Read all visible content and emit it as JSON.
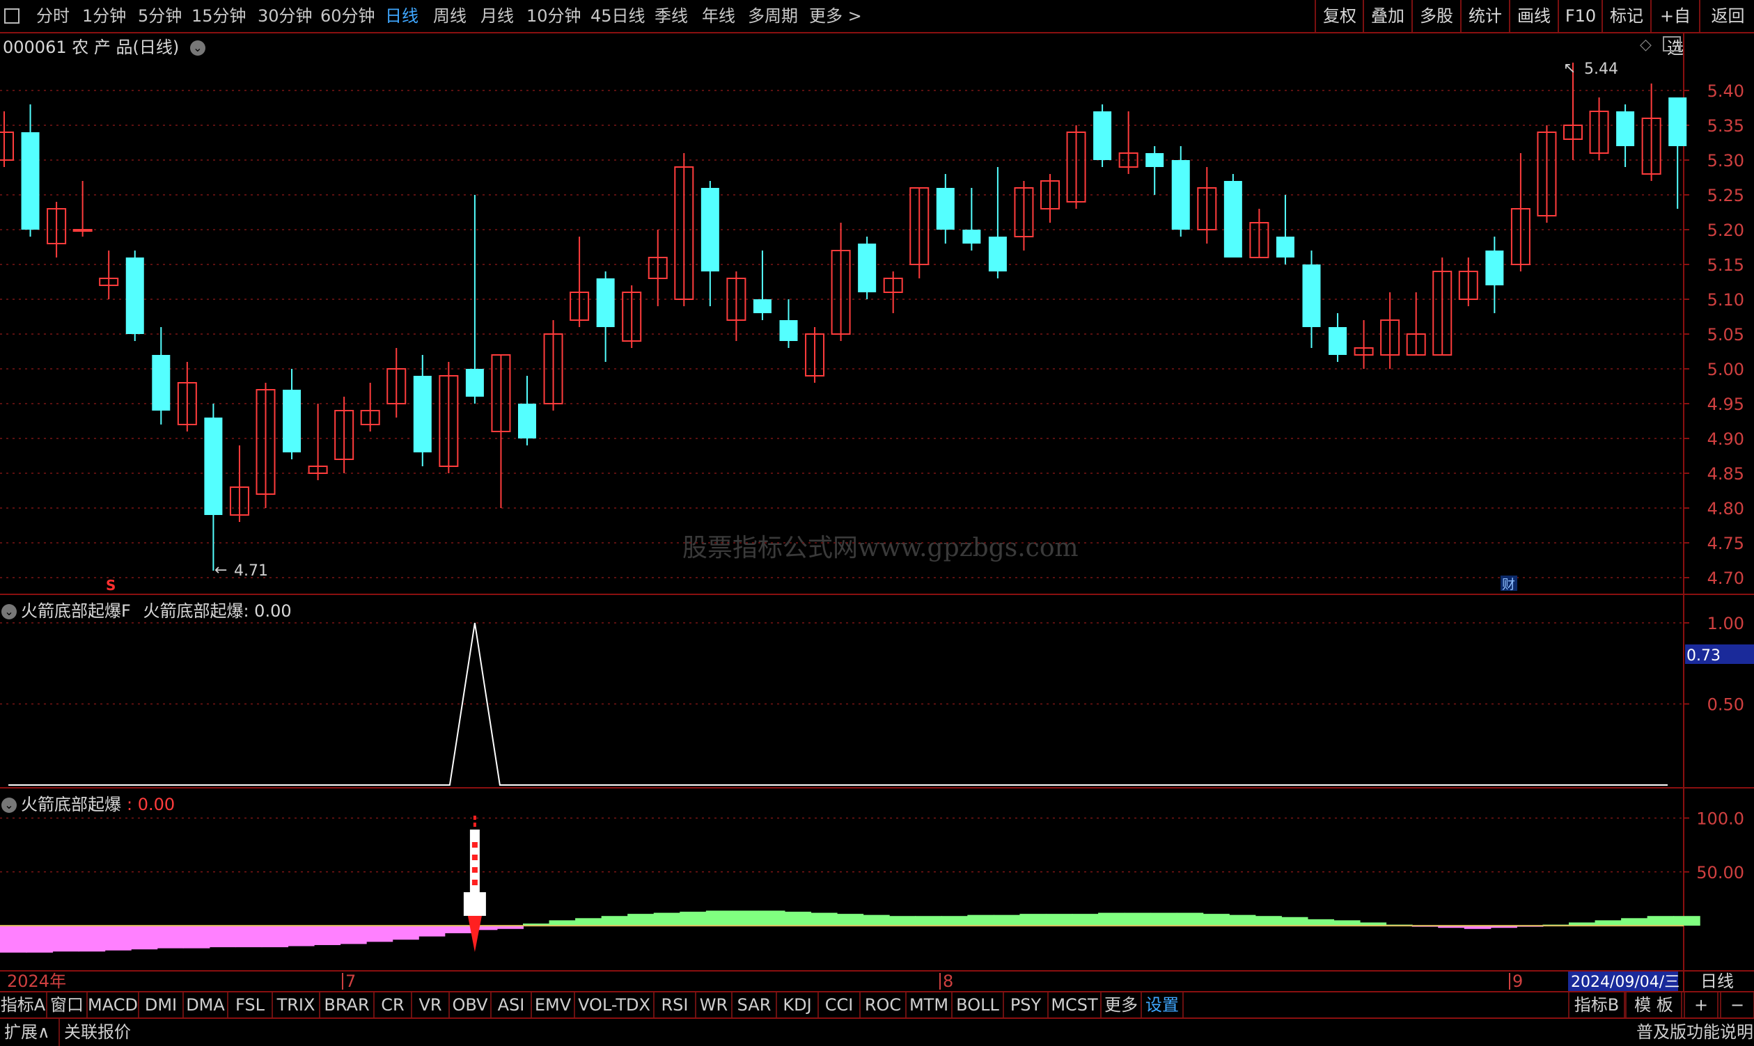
{
  "top_tabs": [
    "分时",
    "1分钟",
    "5分钟",
    "15分钟",
    "30分钟",
    "60分钟",
    "日线",
    "周线",
    "月线",
    "10分钟",
    "45日线",
    "季线",
    "年线",
    "多周期",
    "更多 >"
  ],
  "active_tab": "日线",
  "right_buttons": [
    "复权",
    "叠加",
    "多股",
    "统计",
    "画线",
    "F10",
    "标记",
    "+自选",
    "返回"
  ],
  "main_title": "000061 农 产 品(日线)",
  "watermark": "股票指标公式网www.gpzbgs.com",
  "high_label": "5.44",
  "low_label": "4.71",
  "sell_marker": "S",
  "finance_marker": "财",
  "price_axis": [
    "5.40",
    "5.35",
    "5.30",
    "5.25",
    "5.20",
    "5.15",
    "5.10",
    "5.05",
    "5.00",
    "4.95",
    "4.90",
    "4.85",
    "4.80",
    "4.75",
    "4.70"
  ],
  "indicator1": {
    "title": "火箭底部起爆F",
    "label": "火箭底部起爆",
    "value": ": 0.00",
    "axis": [
      "1.00",
      "0.50"
    ],
    "cursor_value": "0.73"
  },
  "indicator2": {
    "title": "火箭底部起爆",
    "value": ": 0.00",
    "axis": [
      "100.0",
      "50.00"
    ]
  },
  "time_axis": {
    "year": "2024年",
    "m7": "7",
    "m8": "8",
    "m9": "9",
    "cursor_date": "2024/09/04/三",
    "period": "日线"
  },
  "bottom_tabs": [
    "指标A",
    "窗口",
    "MACD",
    "DMI",
    "DMA",
    "FSL",
    "TRIX",
    "BRAR",
    "CR",
    "VR",
    "OBV",
    "ASI",
    "EMV",
    "VOL-TDX",
    "RSI",
    "WR",
    "SAR",
    "KDJ",
    "CCI",
    "ROC",
    "MTM",
    "BOLL",
    "PSY",
    "MCST",
    "更多",
    "设置"
  ],
  "bottom_right": [
    "指标B",
    "模 板",
    "+",
    "−"
  ],
  "status_left": [
    "扩展∧",
    "关联报价"
  ],
  "status_right": "普及版功能说明",
  "colors": {
    "up": "#ff3c3c",
    "down": "#54ffff",
    "border": "#8a1010",
    "grid": "#7a1515",
    "active": "#3fa7ff"
  },
  "chart_data": {
    "type": "candlestick",
    "ylim": [
      4.68,
      5.45
    ],
    "series": [
      {
        "o": 5.3,
        "c": 5.34,
        "h": 5.37,
        "l": 5.29
      },
      {
        "o": 5.34,
        "c": 5.2,
        "h": 5.38,
        "l": 5.19
      },
      {
        "o": 5.18,
        "c": 5.23,
        "h": 5.24,
        "l": 5.16
      },
      {
        "o": 5.2,
        "c": 5.2,
        "h": 5.27,
        "l": 5.19
      },
      {
        "o": 5.12,
        "c": 5.13,
        "h": 5.17,
        "l": 5.1
      },
      {
        "o": 5.16,
        "c": 5.05,
        "h": 5.17,
        "l": 5.04
      },
      {
        "o": 5.02,
        "c": 4.94,
        "h": 5.06,
        "l": 4.92
      },
      {
        "o": 4.92,
        "c": 4.98,
        "h": 5.01,
        "l": 4.91
      },
      {
        "o": 4.93,
        "c": 4.79,
        "h": 4.95,
        "l": 4.71
      },
      {
        "o": 4.79,
        "c": 4.83,
        "h": 4.89,
        "l": 4.78
      },
      {
        "o": 4.82,
        "c": 4.97,
        "h": 4.98,
        "l": 4.8
      },
      {
        "o": 4.97,
        "c": 4.88,
        "h": 5.0,
        "l": 4.87
      },
      {
        "o": 4.85,
        "c": 4.86,
        "h": 4.95,
        "l": 4.84
      },
      {
        "o": 4.87,
        "c": 4.94,
        "h": 4.96,
        "l": 4.85
      },
      {
        "o": 4.92,
        "c": 4.94,
        "h": 4.98,
        "l": 4.91
      },
      {
        "o": 4.95,
        "c": 5.0,
        "h": 5.03,
        "l": 4.93
      },
      {
        "o": 4.99,
        "c": 4.88,
        "h": 5.02,
        "l": 4.86
      },
      {
        "o": 4.86,
        "c": 4.99,
        "h": 5.01,
        "l": 4.85
      },
      {
        "o": 5.0,
        "c": 4.96,
        "h": 5.25,
        "l": 4.95
      },
      {
        "o": 4.91,
        "c": 5.02,
        "h": 5.02,
        "l": 4.8
      },
      {
        "o": 4.95,
        "c": 4.9,
        "h": 4.99,
        "l": 4.89
      },
      {
        "o": 4.95,
        "c": 5.05,
        "h": 5.07,
        "l": 4.94
      },
      {
        "o": 5.07,
        "c": 5.11,
        "h": 5.19,
        "l": 5.06
      },
      {
        "o": 5.13,
        "c": 5.06,
        "h": 5.14,
        "l": 5.01
      },
      {
        "o": 5.04,
        "c": 5.11,
        "h": 5.12,
        "l": 5.03
      },
      {
        "o": 5.13,
        "c": 5.16,
        "h": 5.2,
        "l": 5.09
      },
      {
        "o": 5.1,
        "c": 5.29,
        "h": 5.31,
        "l": 5.09
      },
      {
        "o": 5.26,
        "c": 5.14,
        "h": 5.27,
        "l": 5.09
      },
      {
        "o": 5.07,
        "c": 5.13,
        "h": 5.14,
        "l": 5.04
      },
      {
        "o": 5.1,
        "c": 5.08,
        "h": 5.17,
        "l": 5.07
      },
      {
        "o": 5.07,
        "c": 5.04,
        "h": 5.1,
        "l": 5.03
      },
      {
        "o": 4.99,
        "c": 5.05,
        "h": 5.06,
        "l": 4.98
      },
      {
        "o": 5.05,
        "c": 5.17,
        "h": 5.21,
        "l": 5.04
      },
      {
        "o": 5.18,
        "c": 5.11,
        "h": 5.19,
        "l": 5.1
      },
      {
        "o": 5.11,
        "c": 5.13,
        "h": 5.14,
        "l": 5.08
      },
      {
        "o": 5.15,
        "c": 5.26,
        "h": 5.26,
        "l": 5.13
      },
      {
        "o": 5.26,
        "c": 5.2,
        "h": 5.28,
        "l": 5.18
      },
      {
        "o": 5.2,
        "c": 5.18,
        "h": 5.26,
        "l": 5.17
      },
      {
        "o": 5.19,
        "c": 5.14,
        "h": 5.29,
        "l": 5.13
      },
      {
        "o": 5.19,
        "c": 5.26,
        "h": 5.27,
        "l": 5.17
      },
      {
        "o": 5.23,
        "c": 5.27,
        "h": 5.28,
        "l": 5.21
      },
      {
        "o": 5.24,
        "c": 5.34,
        "h": 5.35,
        "l": 5.23
      },
      {
        "o": 5.37,
        "c": 5.3,
        "h": 5.38,
        "l": 5.29
      },
      {
        "o": 5.29,
        "c": 5.31,
        "h": 5.37,
        "l": 5.28
      },
      {
        "o": 5.31,
        "c": 5.29,
        "h": 5.32,
        "l": 5.25
      },
      {
        "o": 5.3,
        "c": 5.2,
        "h": 5.32,
        "l": 5.19
      },
      {
        "o": 5.2,
        "c": 5.26,
        "h": 5.29,
        "l": 5.18
      },
      {
        "o": 5.27,
        "c": 5.16,
        "h": 5.28,
        "l": 5.16
      },
      {
        "o": 5.16,
        "c": 5.21,
        "h": 5.23,
        "l": 5.16
      },
      {
        "o": 5.19,
        "c": 5.16,
        "h": 5.25,
        "l": 5.15
      },
      {
        "o": 5.15,
        "c": 5.06,
        "h": 5.17,
        "l": 5.03
      },
      {
        "o": 5.06,
        "c": 5.02,
        "h": 5.08,
        "l": 5.01
      },
      {
        "o": 5.02,
        "c": 5.03,
        "h": 5.07,
        "l": 5.0
      },
      {
        "o": 5.02,
        "c": 5.07,
        "h": 5.11,
        "l": 5.0
      },
      {
        "o": 5.02,
        "c": 5.05,
        "h": 5.11,
        "l": 5.02
      },
      {
        "o": 5.02,
        "c": 5.14,
        "h": 5.16,
        "l": 5.02
      },
      {
        "o": 5.1,
        "c": 5.14,
        "h": 5.16,
        "l": 5.09
      },
      {
        "o": 5.17,
        "c": 5.12,
        "h": 5.19,
        "l": 5.08
      },
      {
        "o": 5.15,
        "c": 5.23,
        "h": 5.31,
        "l": 5.14
      },
      {
        "o": 5.22,
        "c": 5.34,
        "h": 5.35,
        "l": 5.21
      },
      {
        "o": 5.33,
        "c": 5.35,
        "h": 5.44,
        "l": 5.3
      },
      {
        "o": 5.31,
        "c": 5.37,
        "h": 5.39,
        "l": 5.3
      },
      {
        "o": 5.37,
        "c": 5.32,
        "h": 5.38,
        "l": 5.29
      },
      {
        "o": 5.28,
        "c": 5.36,
        "h": 5.41,
        "l": 5.27
      },
      {
        "o": 5.39,
        "c": 5.32,
        "h": 5.39,
        "l": 5.23
      }
    ],
    "indicator_f": {
      "spike_index": 18,
      "spike_value": 1.0,
      "baseline": 0.0,
      "ylim": [
        0,
        1.0
      ]
    },
    "rocket_index": 18,
    "wave": [
      -25,
      -25,
      -24,
      -24,
      -23,
      -22,
      -21,
      -21,
      -20,
      -20,
      -20,
      -19,
      -18,
      -17,
      -15,
      -13,
      -10,
      -7,
      -4,
      -3,
      2,
      5,
      7,
      9,
      11,
      12,
      13,
      14,
      14,
      14,
      13,
      12,
      11,
      10,
      9,
      9,
      9,
      10,
      10,
      11,
      11,
      11,
      12,
      12,
      12,
      12,
      11,
      10,
      9,
      8,
      6,
      5,
      3,
      1,
      -1,
      -2,
      -3,
      -2,
      -1,
      1,
      3,
      5,
      7,
      9,
      9
    ],
    "wave_ylim": [
      -40,
      110
    ]
  }
}
